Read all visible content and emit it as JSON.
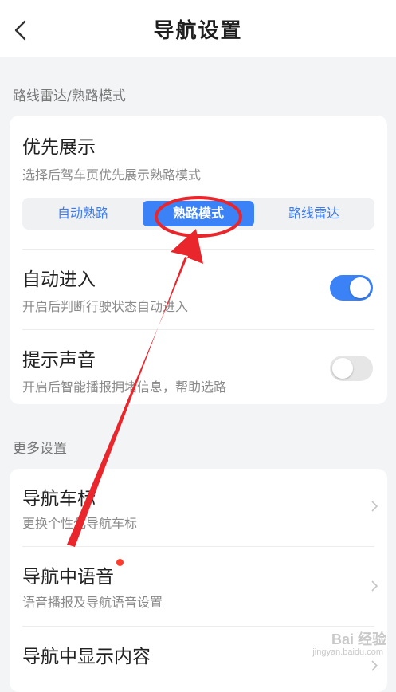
{
  "header": {
    "title": "导航设置",
    "back_icon": "chevron-left-icon"
  },
  "section1": {
    "title": "路线雷达/熟路模式",
    "priority": {
      "title": "优先展示",
      "subtitle": "选择后驾车页优先展示熟路模式",
      "options": [
        "自动熟路",
        "熟路模式",
        "路线雷达"
      ],
      "selected": "熟路模式"
    },
    "auto_enter": {
      "title": "自动进入",
      "subtitle": "开启后判断行驶状态自动进入",
      "enabled": true
    },
    "sound": {
      "title": "提示声音",
      "subtitle": "开启后智能播报拥堵信息，帮助选路",
      "enabled": false
    }
  },
  "section2": {
    "title": "更多设置",
    "items": [
      {
        "title": "导航车标",
        "subtitle": "更换个性化导航车标",
        "badge": false
      },
      {
        "title": "导航中语音",
        "subtitle": "语音播报及导航语音设置",
        "badge": true
      },
      {
        "title": "导航中显示内容",
        "subtitle": "",
        "badge": false
      }
    ]
  },
  "colors": {
    "accent": "#3b82f6",
    "badge": "#ff3b30",
    "annotation": "#e8262b"
  },
  "watermark": {
    "text": "Bai 经验",
    "url": "jingyan.baidu.com"
  }
}
